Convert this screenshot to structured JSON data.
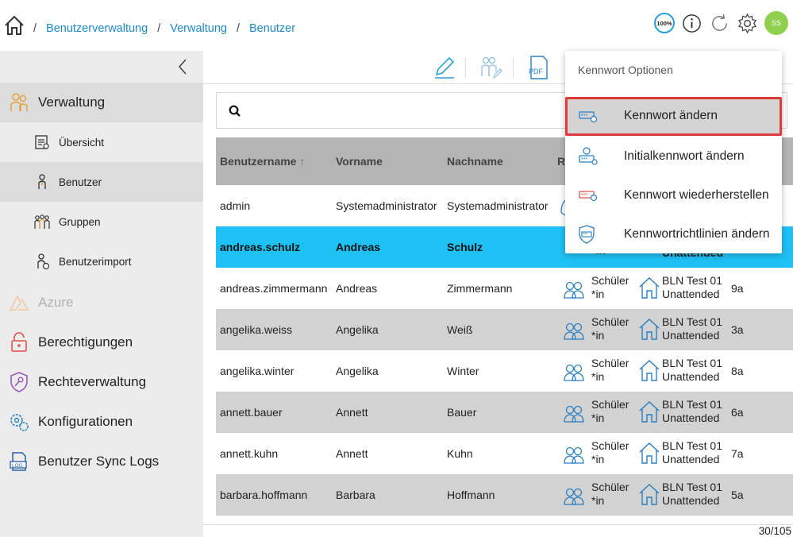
{
  "header": {
    "breadcrumb": [
      "Benutzerverwaltung",
      "Verwaltung",
      "Benutzer"
    ],
    "separator": "/",
    "zoom": "100%",
    "avatar_initials": "SS",
    "icons": [
      "home-icon",
      "info-icon",
      "refresh-icon",
      "gear-icon"
    ]
  },
  "sidebar": {
    "groups": [
      {
        "label": "Verwaltung",
        "icon": "users-admin-icon"
      },
      {
        "label": "Azure",
        "icon": "azure-icon"
      },
      {
        "label": "Berechtigungen",
        "icon": "lock-icon"
      },
      {
        "label": "Rechteverwaltung",
        "icon": "shield-key-icon"
      },
      {
        "label": "Konfigurationen",
        "icon": "gears-icon"
      },
      {
        "label": "Benutzer Sync Logs",
        "icon": "log-icon"
      }
    ],
    "sub_items": [
      {
        "label": "Übersicht",
        "icon": "overview-icon"
      },
      {
        "label": "Benutzer",
        "icon": "user-icon"
      },
      {
        "label": "Gruppen",
        "icon": "group-icon"
      },
      {
        "label": "Benutzerimport",
        "icon": "user-import-icon"
      }
    ]
  },
  "toolbar": {
    "icons": [
      "edit-pencil-icon",
      "user-edit-icon",
      "pdf-icon"
    ],
    "pdf_label": "PDF"
  },
  "table": {
    "columns": [
      "Benutzername",
      "Vorname",
      "Nachname",
      "R"
    ],
    "sort_indicator": "↑",
    "rows": [
      {
        "username": "admin",
        "first": "Systemadministrator",
        "last": "Systemadministrator",
        "role": "",
        "group1": "",
        "group2": "",
        "class": ""
      },
      {
        "username": "andreas.schulz",
        "first": "Andreas",
        "last": "Schulz",
        "role": "*in",
        "group1": "",
        "group2": "Unattended",
        "class": ""
      },
      {
        "username": "andreas.zimmermann",
        "first": "Andreas",
        "last": "Zimmermann",
        "role": "Schüler\n*in",
        "group1": "BLN Test 01",
        "group2": "Unattended",
        "class": "9a"
      },
      {
        "username": "angelika.weiss",
        "first": "Angelika",
        "last": "Weiß",
        "role": "Schüler\n*in",
        "group1": "BLN Test 01",
        "group2": "Unattended",
        "class": "3a"
      },
      {
        "username": "angelika.winter",
        "first": "Angelika",
        "last": "Winter",
        "role": "Schüler\n*in",
        "group1": "BLN Test 01",
        "group2": "Unattended",
        "class": "8a"
      },
      {
        "username": "annett.bauer",
        "first": "Annett",
        "last": "Bauer",
        "role": "Schüler\n*in",
        "group1": "BLN Test 01",
        "group2": "Unattended",
        "class": "6a"
      },
      {
        "username": "annett.kuhn",
        "first": "Annett",
        "last": "Kuhn",
        "role": "Schüler\n*in",
        "group1": "BLN Test 01",
        "group2": "Unattended",
        "class": "7a"
      },
      {
        "username": "barbara.hoffmann",
        "first": "Barbara",
        "last": "Hoffmann",
        "role": "Schüler\n*in",
        "group1": "BLN Test 01",
        "group2": "Unattended",
        "class": "5a"
      }
    ]
  },
  "pagination": {
    "count": "30/105"
  },
  "dropdown": {
    "title": "Kennwort Optionen",
    "items": [
      {
        "label": "Kennwort ändern",
        "icon": "password-change-icon"
      },
      {
        "label": "Initialkennwort ändern",
        "icon": "initial-password-icon"
      },
      {
        "label": "Kennwort wiederherstellen",
        "icon": "password-restore-icon"
      },
      {
        "label": "Kennwortrichtlinien ändern",
        "icon": "password-policy-icon"
      }
    ]
  },
  "colors": {
    "accent": "#1e88c8",
    "selected_row": "#1ec1f4",
    "highlight_border": "#e0393a",
    "avatar": "#8fd14f"
  }
}
